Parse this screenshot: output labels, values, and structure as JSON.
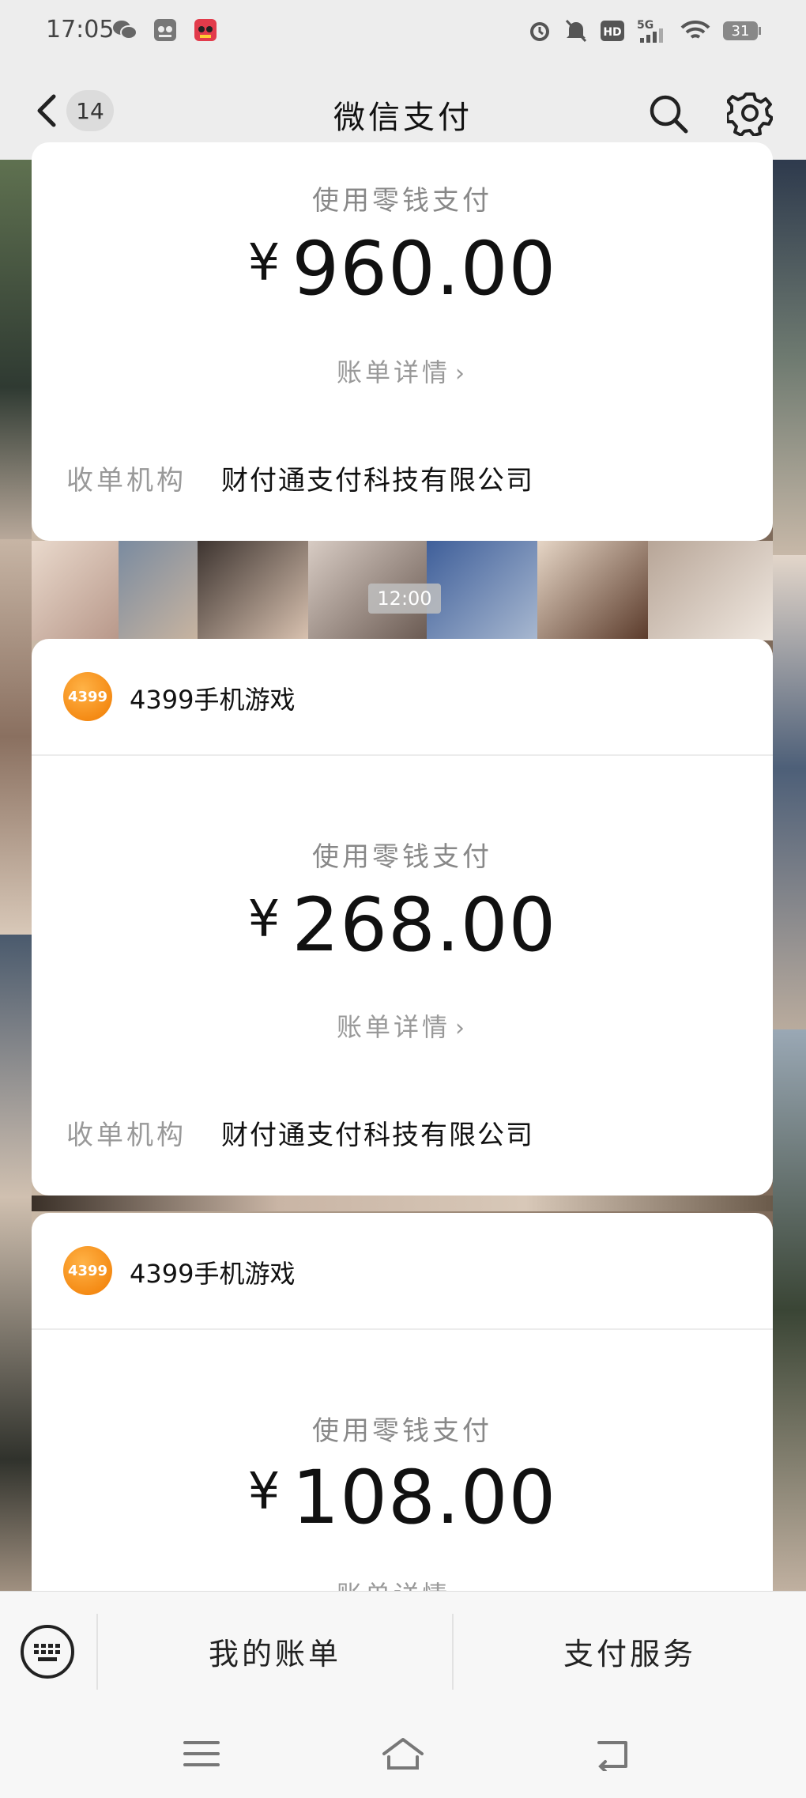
{
  "status_bar": {
    "time": "17:05",
    "battery": "31",
    "network": "5G",
    "hd_label": "HD"
  },
  "nav": {
    "unread_count": "14",
    "title": "微信支付"
  },
  "messages": [
    {
      "merchant": "",
      "pay_method": "使用零钱支付",
      "currency": "¥",
      "amount": "960.00",
      "detail_link": "账单详情",
      "acquirer_label": "收单机构",
      "acquirer": "财付通支付科技有限公司"
    },
    {
      "merchant": "4399手机游戏",
      "merchant_logo_text": "4399",
      "pay_method": "使用零钱支付",
      "currency": "¥",
      "amount": "268.00",
      "detail_link": "账单详情",
      "acquirer_label": "收单机构",
      "acquirer": "财付通支付科技有限公司"
    },
    {
      "merchant": "4399手机游戏",
      "merchant_logo_text": "4399",
      "pay_method": "使用零钱支付",
      "currency": "¥",
      "amount": "108.00",
      "detail_link": "账单详情"
    }
  ],
  "timestamp": "12:00",
  "bottom_menu": {
    "items": [
      "我的账单",
      "支付服务"
    ]
  },
  "colors": {
    "background": "#ededed",
    "card": "#ffffff",
    "logo_orange": "#f07a00"
  }
}
